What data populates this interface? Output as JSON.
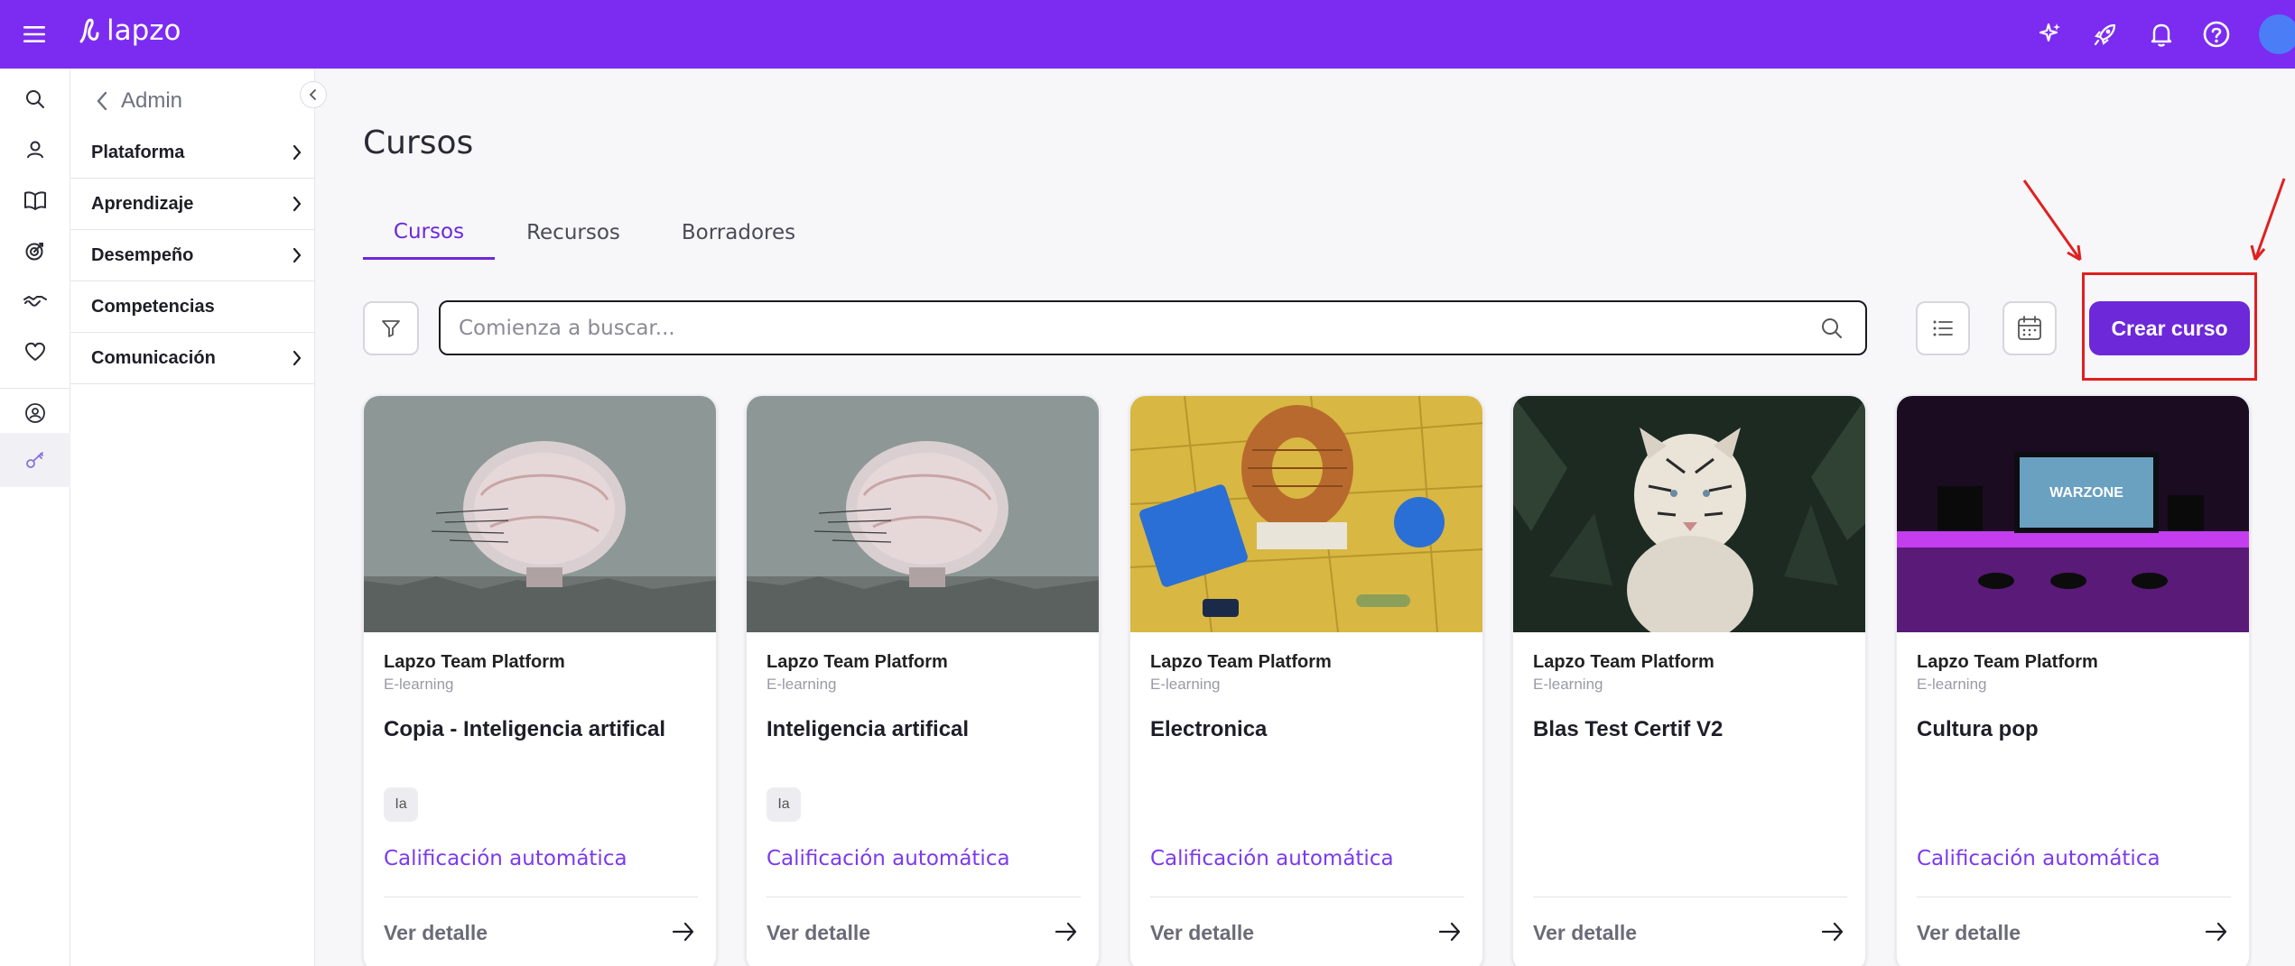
{
  "app": {
    "logo_text": "lapzo",
    "brand_color": "#7c2cf0",
    "accent_color": "#6d28d9"
  },
  "topbar": {
    "icons": [
      "sparkles-icon",
      "rocket-icon",
      "bell-icon",
      "help-icon"
    ]
  },
  "rail": {
    "icons": [
      "search-icon",
      "user-icon",
      "book-icon",
      "target-icon",
      "handshake-icon",
      "heart-icon",
      "team-icon",
      "key-icon"
    ]
  },
  "sidebar": {
    "back_label": "Admin",
    "items": [
      {
        "label": "Plataforma",
        "has_children": true
      },
      {
        "label": "Aprendizaje",
        "has_children": true
      },
      {
        "label": "Desempeño",
        "has_children": true
      },
      {
        "label": "Competencias",
        "has_children": false
      },
      {
        "label": "Comunicación",
        "has_children": true
      }
    ]
  },
  "main": {
    "title": "Cursos",
    "tabs": [
      {
        "label": "Cursos",
        "active": true
      },
      {
        "label": "Recursos",
        "active": false
      },
      {
        "label": "Borradores",
        "active": false
      }
    ],
    "search": {
      "placeholder": "Comienza a buscar...",
      "value": ""
    },
    "create_button": "Crear curso"
  },
  "cards": [
    {
      "provider": "Lapzo Team Platform",
      "type": "E-learning",
      "title": "Copia - Inteligencia artifical",
      "tag": "Ia",
      "auto_label": "Calificación automática",
      "detail_label": "Ver detalle",
      "image": "brain-image"
    },
    {
      "provider": "Lapzo Team Platform",
      "type": "E-learning",
      "title": "Inteligencia artifical",
      "tag": "Ia",
      "auto_label": "Calificación automática",
      "detail_label": "Ver detalle",
      "image": "brain-image"
    },
    {
      "provider": "Lapzo Team Platform",
      "type": "E-learning",
      "title": "Electronica",
      "tag": "",
      "auto_label": "Calificación automática",
      "detail_label": "Ver detalle",
      "image": "electronics-image"
    },
    {
      "provider": "Lapzo Team Platform",
      "type": "E-learning",
      "title": "Blas Test Certif V2",
      "tag": "",
      "auto_label": "",
      "detail_label": "Ver detalle",
      "image": "tiger-image"
    },
    {
      "provider": "Lapzo Team Platform",
      "type": "E-learning",
      "title": "Cultura pop",
      "tag": "",
      "auto_label": "Calificación automática",
      "detail_label": "Ver detalle",
      "image": "gaming-setup-image"
    }
  ]
}
